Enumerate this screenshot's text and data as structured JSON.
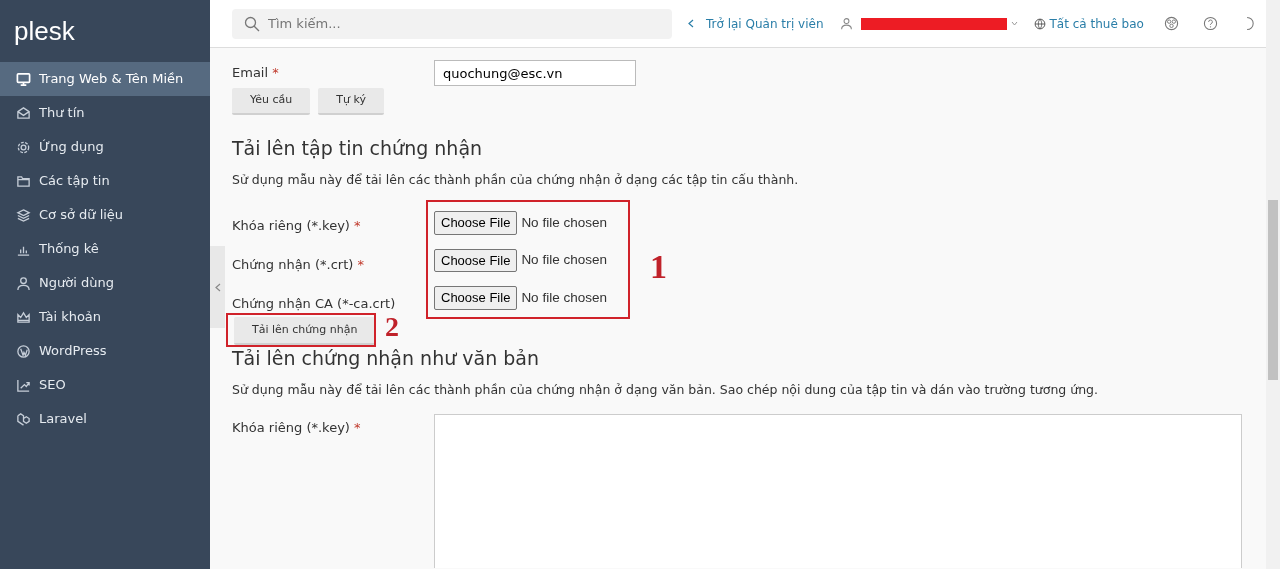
{
  "sidebar": {
    "logo": "plesk",
    "items": [
      {
        "label": "Trang Web & Tên Miền",
        "selected": true
      },
      {
        "label": "Thư tín",
        "selected": false
      },
      {
        "label": "Ứng dụng",
        "selected": false
      },
      {
        "label": "Các tập tin",
        "selected": false
      },
      {
        "label": "Cơ sở dữ liệu",
        "selected": false
      },
      {
        "label": "Thống kê",
        "selected": false
      },
      {
        "label": "Người dùng",
        "selected": false
      },
      {
        "label": "Tài khoản",
        "selected": false
      },
      {
        "label": "WordPress",
        "selected": false
      },
      {
        "label": "SEO",
        "selected": false
      },
      {
        "label": "Laravel",
        "selected": false
      }
    ]
  },
  "header": {
    "search": {
      "placeholder": "Tìm kiếm..."
    },
    "back_link": "Trở lại Quản trị viên",
    "user_menu": {
      "redacted": true
    },
    "subscriptions_link": "Tất cả thuê bao"
  },
  "email_row": {
    "label": "Email",
    "required_mark": "*",
    "value": "quochung@esc.vn",
    "buttons": [
      "Yêu cầu",
      "Tự ký"
    ]
  },
  "file_section": {
    "title": "Tải lên tập tin chứng nhận",
    "description": "Sử dụng mẫu này để tải lên các thành phần của chứng nhận ở dạng các tập tin cấu thành.",
    "fields": [
      {
        "label": "Khóa riêng (*.key)",
        "required_mark": "*",
        "button": "Choose File",
        "status": "No file chosen"
      },
      {
        "label": "Chứng nhận (*.crt)",
        "required_mark": "*",
        "button": "Choose File",
        "status": "No file chosen"
      },
      {
        "label": "Chứng nhận CA (*-ca.crt)",
        "button": "Choose File",
        "status": "No file chosen"
      }
    ],
    "fields_annotation": "1",
    "submit": "Tải lên chứng nhận",
    "submit_annotation": "2"
  },
  "text_section": {
    "title": "Tải lên chứng nhận như văn bản",
    "description": "Sử dụng mẫu này để tải lên các thành phần của chứng nhận ở dạng văn bản. Sao chép nội dung của tập tin và dán vào trường tương ứng.",
    "fields": [
      {
        "label": "Khóa riêng (*.key)",
        "required_mark": "*"
      }
    ]
  }
}
